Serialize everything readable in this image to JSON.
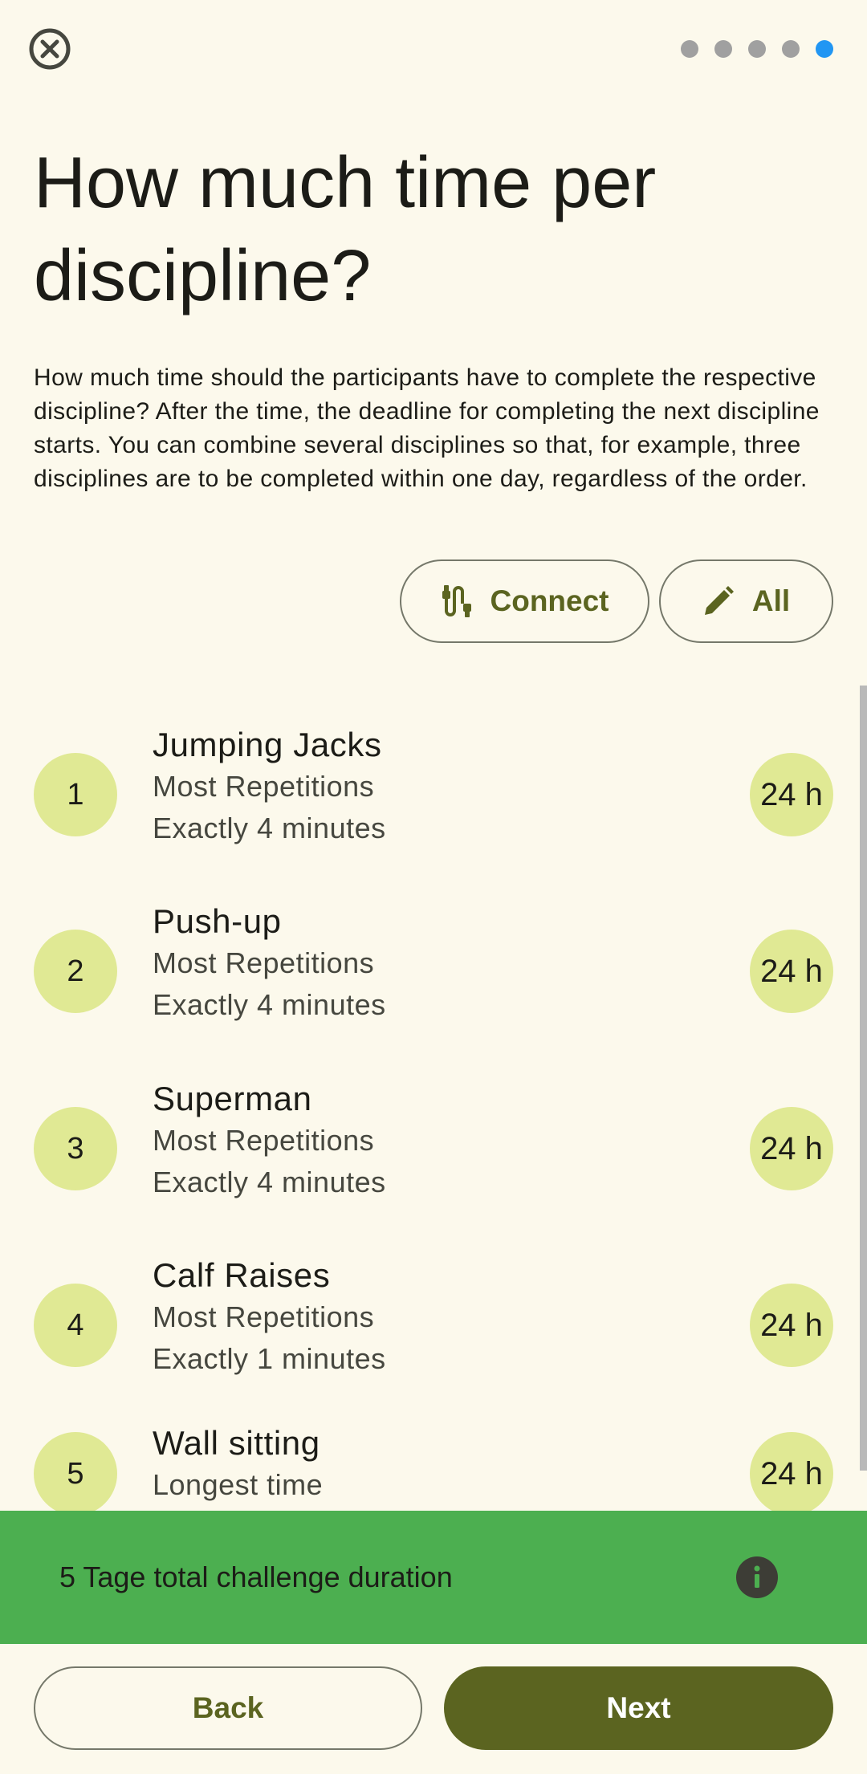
{
  "progress": {
    "steps": 5,
    "current_step": 5,
    "active_color": "#2196f3",
    "inactive_color": "#a0a0a0"
  },
  "icons": {
    "close": "close-circle-icon",
    "connect": "connect-cable-icon",
    "all": "pencil-icon",
    "info": "info-icon"
  },
  "header": {
    "title": "How much time per discipline?",
    "description": "How much time should the participants have to complete the respective discipline? After the time, the deadline for completing the next discipline starts. You can combine several disciplines so that, for example, three disciplines are to be completed within one day, regardless of the order."
  },
  "actions": {
    "connect_label": "Connect",
    "all_label": "All"
  },
  "disciplines": [
    {
      "number": "1",
      "name": "Jumping Jacks",
      "mode": "Most Repetitions",
      "limit": "Exactly 4 minutes",
      "duration": "24 h"
    },
    {
      "number": "2",
      "name": "Push-up",
      "mode": "Most Repetitions",
      "limit": "Exactly 4 minutes",
      "duration": "24 h"
    },
    {
      "number": "3",
      "name": "Superman",
      "mode": "Most Repetitions",
      "limit": "Exactly 4 minutes",
      "duration": "24 h"
    },
    {
      "number": "4",
      "name": "Calf Raises",
      "mode": "Most Repetitions",
      "limit": "Exactly 1 minutes",
      "duration": "24 h"
    },
    {
      "number": "5",
      "name": "Wall sitting",
      "mode": "Longest time",
      "limit": "",
      "duration": "24 h"
    }
  ],
  "summary": {
    "text": "5 Tage total challenge duration",
    "color": "#4caf50"
  },
  "footer": {
    "back_label": "Back",
    "next_label": "Next"
  },
  "colors": {
    "background": "#fcf9ec",
    "accent": "#5b6420",
    "chip_fill": "#e0e994"
  }
}
